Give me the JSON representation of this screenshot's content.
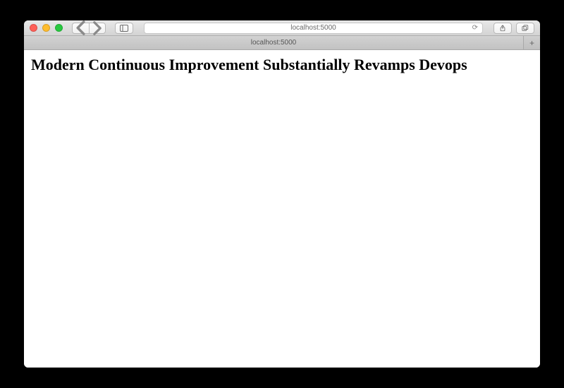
{
  "address_bar": {
    "url": "localhost:5000"
  },
  "tab": {
    "title": "localhost:5000"
  },
  "page": {
    "heading": "Modern Continuous Improvement Substantially Revamps Devops"
  }
}
